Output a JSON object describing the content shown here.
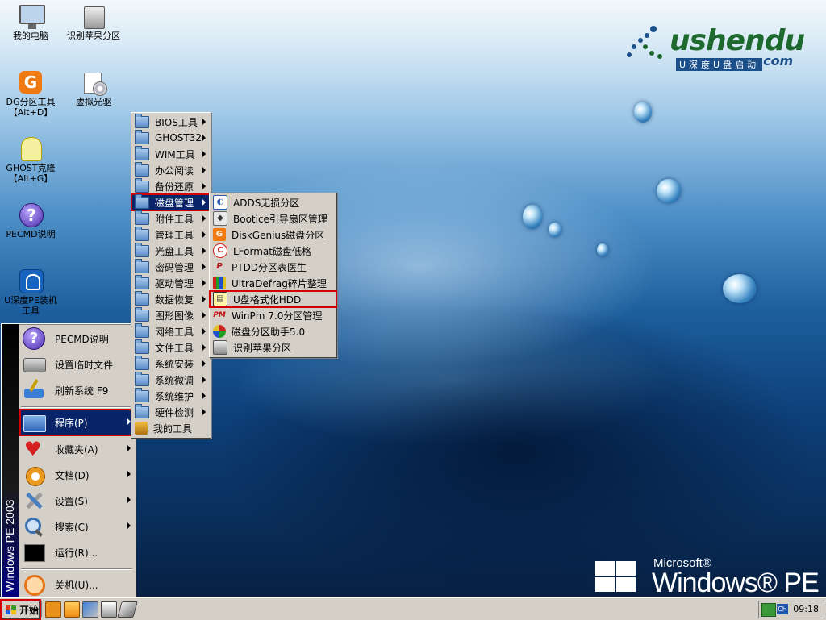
{
  "desktop": {
    "icons": [
      {
        "label": "我的电脑"
      },
      {
        "label": "识别苹果分区"
      },
      {
        "label": "DG分区工具\n【Alt+D】"
      },
      {
        "label": "虚拟光驱"
      },
      {
        "label": "GHOST克隆\n【Alt+G】"
      },
      {
        "label": "PECMD说明"
      },
      {
        "label": "U深度PE装机\n工具"
      }
    ],
    "logo": {
      "text_main": "ushendu",
      "text_sub": "U深度U盘启动",
      "text_domain": ".com"
    },
    "brand": {
      "company": "Microsoft®",
      "product": "Windows® PE"
    }
  },
  "start_menu": {
    "side_label": "Windows PE 2003",
    "items": [
      {
        "label": "PECMD说明",
        "icon": "help-icon"
      },
      {
        "label": "设置临时文件",
        "icon": "drive-settings-icon"
      },
      {
        "label": "刷新系统 F9",
        "icon": "refresh-broom-icon"
      },
      {
        "label": "程序(P)",
        "icon": "programs-icon",
        "submenu": true,
        "selected": true
      },
      {
        "label": "收藏夹(A)",
        "icon": "favorites-heart-icon",
        "submenu": true
      },
      {
        "label": "文档(D)",
        "icon": "documents-icon",
        "submenu": true
      },
      {
        "label": "设置(S)",
        "icon": "settings-tools-icon",
        "submenu": true
      },
      {
        "label": "搜索(C)",
        "icon": "search-icon",
        "submenu": true
      },
      {
        "label": "运行(R)...",
        "icon": "run-icon"
      },
      {
        "label": "关机(U)...",
        "icon": "shutdown-icon"
      }
    ]
  },
  "programs_menu": {
    "items": [
      {
        "label": "BIOS工具",
        "submenu": true
      },
      {
        "label": "GHOST32",
        "submenu": true
      },
      {
        "label": "WIM工具",
        "submenu": true
      },
      {
        "label": "办公阅读",
        "submenu": true
      },
      {
        "label": "备份还原",
        "submenu": true
      },
      {
        "label": "磁盘管理",
        "submenu": true,
        "selected": true
      },
      {
        "label": "附件工具",
        "submenu": true
      },
      {
        "label": "管理工具",
        "submenu": true
      },
      {
        "label": "光盘工具",
        "submenu": true
      },
      {
        "label": "密码管理",
        "submenu": true
      },
      {
        "label": "驱动管理",
        "submenu": true
      },
      {
        "label": "数据恢复",
        "submenu": true
      },
      {
        "label": "图形图像",
        "submenu": true
      },
      {
        "label": "网络工具",
        "submenu": true
      },
      {
        "label": "文件工具",
        "submenu": true
      },
      {
        "label": "系统安装",
        "submenu": true
      },
      {
        "label": "系统微调",
        "submenu": true
      },
      {
        "label": "系统维护",
        "submenu": true
      },
      {
        "label": "硬件检测",
        "submenu": true
      },
      {
        "label": "我的工具",
        "submenu": false
      }
    ]
  },
  "disk_menu": {
    "items": [
      {
        "label": "ADDS无损分区",
        "icon": "adds-icon"
      },
      {
        "label": "Bootice引导扇区管理",
        "icon": "bootice-icon"
      },
      {
        "label": "DiskGenius磁盘分区",
        "icon": "diskgenius-icon"
      },
      {
        "label": "LFormat磁盘低格",
        "icon": "lformat-icon"
      },
      {
        "label": "PTDD分区表医生",
        "icon": "ptdd-icon"
      },
      {
        "label": "UltraDefrag碎片整理",
        "icon": "ultradefrag-icon"
      },
      {
        "label": "U盘格式化HDD",
        "icon": "usb-format-icon",
        "highlighted": true
      },
      {
        "label": "WinPm 7.0分区管理",
        "icon": "winpm-icon"
      },
      {
        "label": "磁盘分区助手5.0",
        "icon": "partition-assistant-icon"
      },
      {
        "label": "识别苹果分区",
        "icon": "apple-partition-icon"
      }
    ]
  },
  "taskbar": {
    "start_label": "开始",
    "quick_launch": [
      "browser-icon",
      "window-icon",
      "tools-icon",
      "printer-icon",
      "eraser-icon"
    ],
    "tray": {
      "lang": "CH",
      "clock": "09:18"
    }
  },
  "colors": {
    "selection": "#0a246a",
    "highlight_border": "#d40000",
    "menu_bg": "#d4d0c8"
  }
}
